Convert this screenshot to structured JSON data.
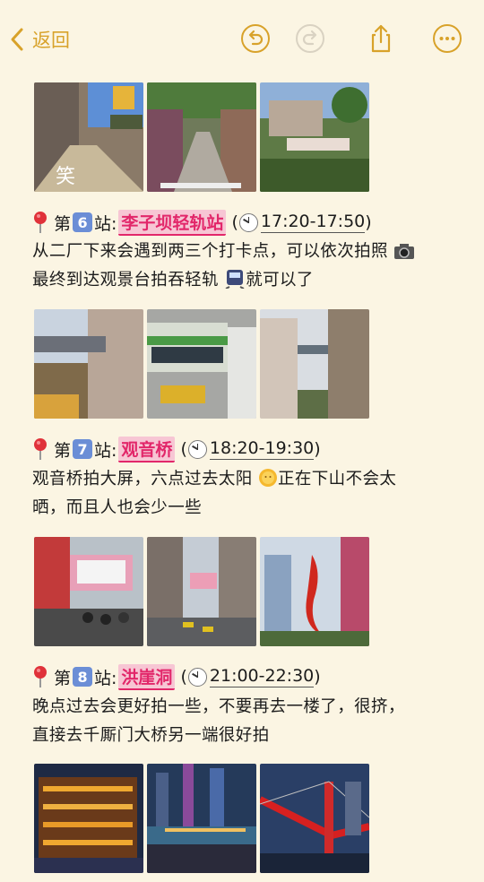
{
  "nav": {
    "back_label": "返回",
    "icons": [
      "undo-icon",
      "redo-icon",
      "share-icon",
      "more-icon"
    ]
  },
  "sections": [
    {
      "stop_prefix": "第",
      "stop_number": "6",
      "stop_suffix": "站:",
      "place": "李子坝轻轨站",
      "time": "17:20-17:50",
      "lines": [
        "从二厂下来会遇到两三个打卡点，可以依次拍照",
        "最终到达观景台拍吞轻轨",
        "就可以了"
      ]
    },
    {
      "stop_prefix": "第",
      "stop_number": "7",
      "stop_suffix": "站:",
      "place": "观音桥",
      "time": "18:20-19:30",
      "lines": [
        "观音桥拍大屏，六点过去太阳",
        "正在下山不会太",
        "晒，而且人也会少一些"
      ]
    },
    {
      "stop_prefix": "第",
      "stop_number": "8",
      "stop_suffix": "站:",
      "place": "洪崖洞",
      "time": "21:00-22:30",
      "lines": [
        "晚点过去会更好拍一些，不要再去一楼了，很挤，",
        "直接去千厮门大桥另一端很好拍"
      ]
    }
  ],
  "colors": {
    "background": "#fbf5e3",
    "accent": "#d8a22a",
    "highlight_bg": "#f7c6d4",
    "highlight_text": "#e2276a",
    "number_badge": "#6b8ed6"
  }
}
